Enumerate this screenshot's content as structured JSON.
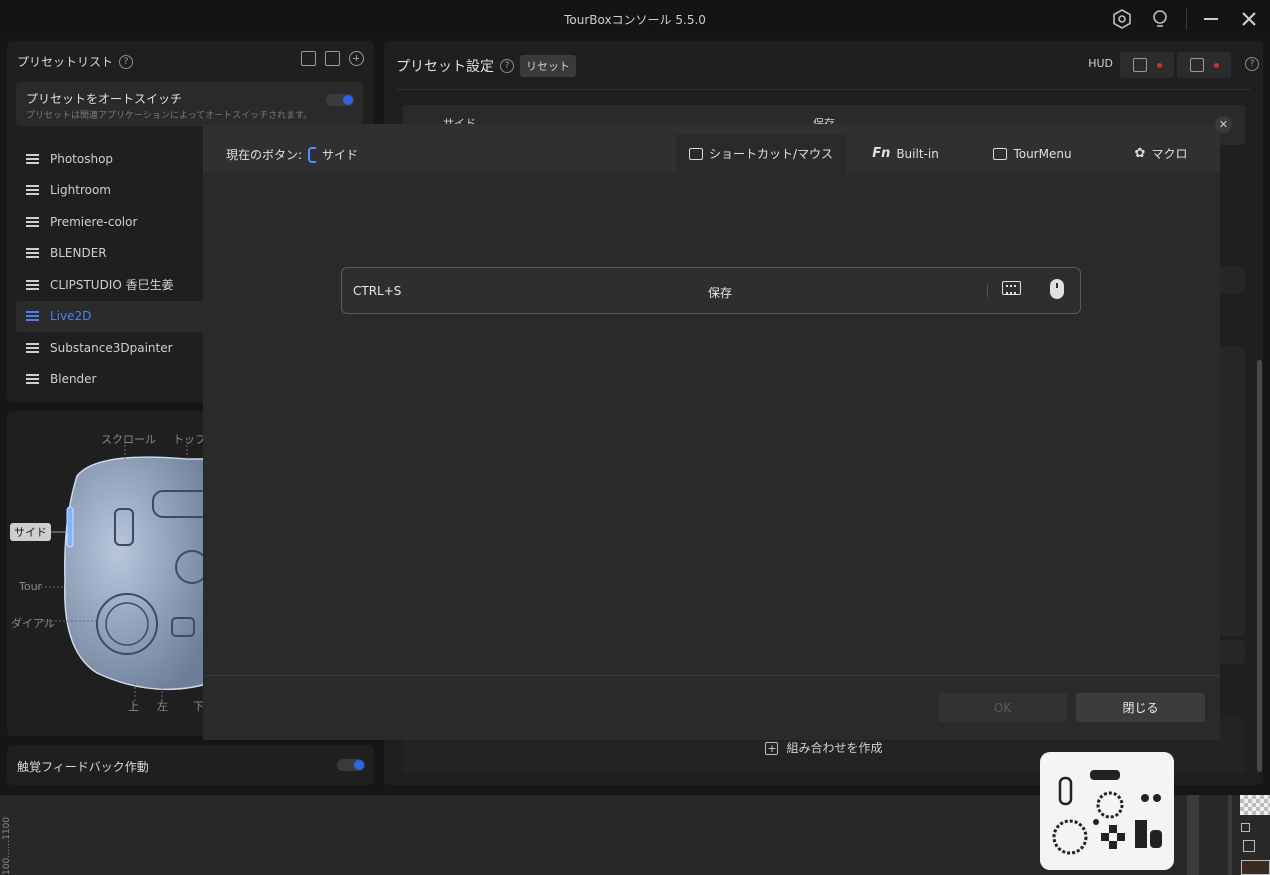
{
  "app": {
    "title": "TourBoxコンソール 5.5.0"
  },
  "preset_list": {
    "header": "プリセットリスト",
    "autoswitch": {
      "title": "プリセットをオートスイッチ",
      "description": "プリセットは関連アプリケーションによってオートスイッチされます。",
      "enabled": true
    },
    "items": [
      {
        "label": "Photoshop",
        "active": false
      },
      {
        "label": "Lightroom",
        "active": false
      },
      {
        "label": "Premiere-color",
        "active": false
      },
      {
        "label": "BLENDER",
        "active": false
      },
      {
        "label": "CLIPSTUDIO 香巳生姜",
        "active": false
      },
      {
        "label": "Live2D",
        "active": true
      },
      {
        "label": "Substance3Dpainter",
        "active": false
      },
      {
        "label": "Blender",
        "active": false
      }
    ]
  },
  "device": {
    "labels": {
      "scroll": "スクロール",
      "top": "トップ",
      "side": "サイド",
      "tour": "Tour",
      "dial": "ダイアル",
      "up": "上",
      "left": "左",
      "down": "下"
    }
  },
  "haptic": {
    "label": "触覚フィードバック作動",
    "enabled": true
  },
  "preset_settings": {
    "header": "プリセット設定",
    "reset_label": "リセット",
    "hud_label": "HUD",
    "row": {
      "button": "サイド",
      "action": "保存"
    },
    "combo_label": "組み合わせを作成"
  },
  "dialog": {
    "current_button_label": "現在のボタン:",
    "current_button_value": "サイド",
    "tabs": [
      {
        "label": "ショートカット/マウス",
        "icon": "keyboard-mouse-icon",
        "active": true
      },
      {
        "label": "Built-in",
        "icon": "fn-icon",
        "active": false
      },
      {
        "label": "TourMenu",
        "icon": "tourmenu-icon",
        "active": false
      },
      {
        "label": "マクロ",
        "icon": "macro-icon",
        "active": false
      }
    ],
    "shortcut": {
      "keys": "CTRL+S",
      "name": "保存"
    },
    "ok_label": "OK",
    "close_label": "閉じる"
  },
  "bottom": {
    "ruler_text": "100……1100"
  }
}
